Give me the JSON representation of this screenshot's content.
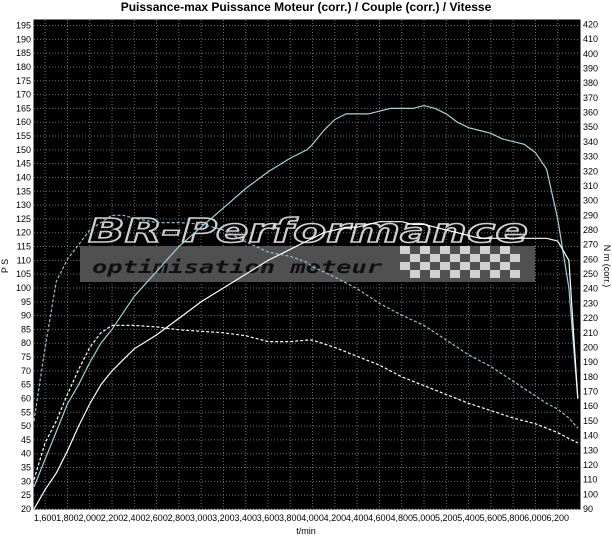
{
  "chart_data": {
    "type": "line",
    "title": "Puissance-max Puissance Moteur (corr.) / Couple (corr.) / Vitesse",
    "xlabel": "t/min",
    "ylabel_left": "P S",
    "ylabel_right": "N m (corr.)",
    "xlim": [
      1500,
      6400
    ],
    "ylim_left": [
      20,
      197
    ],
    "ylim_right": [
      90,
      423
    ],
    "x_ticks": [
      "1,600",
      "1,800",
      "2,000",
      "2,200",
      "2,400",
      "2,600",
      "2,800",
      "3,000",
      "3,200",
      "3,400",
      "3,600",
      "3,800",
      "4,000",
      "4,200",
      "4,400",
      "4,600",
      "4,800",
      "5,000",
      "5,200",
      "5,400",
      "5,600",
      "5,800",
      "6,000",
      "6,200"
    ],
    "y_left_ticks": [
      "20",
      "25",
      "30",
      "35",
      "40",
      "45",
      "50",
      "55",
      "60",
      "65",
      "70",
      "75",
      "80",
      "85",
      "90",
      "95",
      "100",
      "105",
      "110",
      "115",
      "120",
      "125",
      "130",
      "135",
      "140",
      "145",
      "150",
      "155",
      "160",
      "165",
      "170",
      "175",
      "180",
      "185",
      "190",
      "195"
    ],
    "y_right_ticks": [
      "90",
      "100",
      "110",
      "120",
      "130",
      "140",
      "150",
      "160",
      "170",
      "180",
      "190",
      "200",
      "210",
      "220",
      "230",
      "240",
      "250",
      "260",
      "270",
      "280",
      "290",
      "300",
      "310",
      "320",
      "330",
      "340",
      "350",
      "360",
      "370",
      "380",
      "390",
      "400",
      "410",
      "420"
    ],
    "grid": true,
    "background": "#000000",
    "series": [
      {
        "color": "#9fd4dc",
        "dash": "solid",
        "axis": "left",
        "x": [
          1500,
          1600,
          1700,
          1800,
          1900,
          2000,
          2100,
          2200,
          2300,
          2400,
          2600,
          2800,
          3000,
          3200,
          3400,
          3600,
          3800,
          3950,
          4000,
          4100,
          4200,
          4300,
          4400,
          4500,
          4600,
          4700,
          4800,
          4900,
          5000,
          5100,
          5200,
          5300,
          5400,
          5500,
          5600,
          5700,
          5800,
          5900,
          6000,
          6100,
          6200,
          6300,
          6380
        ],
        "y": [
          28,
          38,
          48,
          58,
          65,
          73,
          80,
          85,
          91,
          97,
          106,
          115,
          122,
          129,
          136,
          142,
          147,
          150,
          152,
          157,
          161,
          163,
          163,
          163,
          164,
          165,
          165,
          165,
          166,
          165,
          163,
          160,
          158,
          157,
          156,
          154,
          153,
          152,
          149,
          143,
          125,
          100,
          60
        ]
      },
      {
        "color": "#ffffff",
        "dash": "solid",
        "axis": "left",
        "x": [
          1500,
          1600,
          1700,
          1800,
          1900,
          2000,
          2100,
          2200,
          2300,
          2400,
          2600,
          2800,
          3000,
          3200,
          3400,
          3600,
          3800,
          3950,
          4000,
          4100,
          4200,
          4300,
          4400,
          4500,
          4600,
          4700,
          4800,
          4900,
          5000,
          5100,
          5200,
          5300,
          5400,
          5500,
          5600,
          5700,
          5800,
          5900,
          6000,
          6100,
          6200,
          6300,
          6380
        ],
        "y": [
          20,
          27,
          33,
          41,
          50,
          58,
          65,
          70,
          74,
          78,
          83,
          89,
          95,
          100,
          105,
          110,
          114,
          117,
          118,
          120,
          121,
          122,
          122,
          123,
          124,
          124,
          124,
          123,
          123,
          122,
          121,
          120,
          119,
          118,
          118,
          118,
          118,
          118,
          118,
          118,
          117,
          110,
          60
        ]
      },
      {
        "color": "#8fc4cc",
        "dash": "dashed",
        "axis": "right",
        "x": [
          1500,
          1600,
          1700,
          1800,
          1900,
          2000,
          2100,
          2200,
          2300,
          2400,
          2600,
          2800,
          3000,
          3200,
          3400,
          3600,
          3800,
          3950,
          4000,
          4200,
          4400,
          4600,
          4800,
          5000,
          5200,
          5400,
          5600,
          5800,
          6000,
          6100,
          6200,
          6300,
          6380
        ],
        "y": [
          150,
          200,
          245,
          260,
          270,
          280,
          285,
          290,
          290,
          288,
          285,
          285,
          284,
          280,
          272,
          265,
          262,
          258,
          255,
          248,
          240,
          230,
          222,
          215,
          205,
          195,
          187,
          177,
          167,
          162,
          158,
          152,
          145
        ]
      },
      {
        "color": "#ffffff",
        "dash": "dashed",
        "axis": "right",
        "x": [
          1500,
          1600,
          1700,
          1800,
          1900,
          2000,
          2100,
          2200,
          2300,
          2400,
          2600,
          2800,
          3000,
          3200,
          3400,
          3600,
          3800,
          3950,
          4000,
          4200,
          4400,
          4600,
          4800,
          5000,
          5200,
          5400,
          5600,
          5800,
          6000,
          6100,
          6200,
          6300,
          6380
        ],
        "y": [
          110,
          135,
          150,
          168,
          185,
          200,
          210,
          215,
          215,
          215,
          214,
          212,
          211,
          210,
          208,
          204,
          204,
          205,
          205,
          200,
          194,
          188,
          180,
          174,
          168,
          162,
          157,
          152,
          148,
          145,
          142,
          138,
          135
        ]
      }
    ]
  },
  "watermark": {
    "brand": "BR-Performance",
    "tagline": "optimisation moteur"
  },
  "colors": {
    "plot_background": "#000000",
    "grid": "#6f6f6f",
    "band": "#505050"
  }
}
